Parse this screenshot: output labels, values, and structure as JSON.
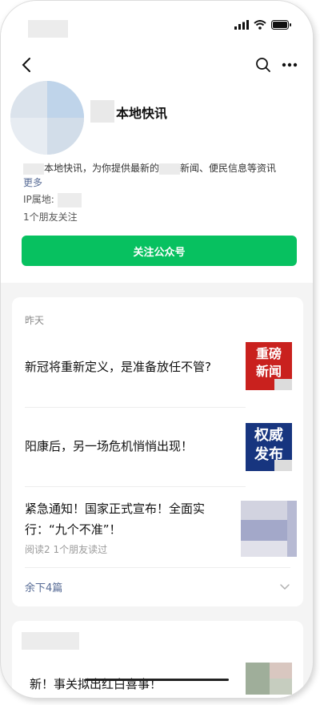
{
  "header": {
    "account_name": "本地快讯",
    "description": "本地快讯，为你提供最新的",
    "description_tail": "新闻、便民信息等资讯",
    "more_link": "更多",
    "ip_label": "IP属地:",
    "friends_following": "1个朋友关注",
    "follow_button": "关注公众号"
  },
  "feed": {
    "date": "昨天",
    "articles": [
      {
        "title": "新冠将重新定义，是准备放任不管?",
        "thumb_text": "重磅新闻",
        "thumb_style": "red"
      },
      {
        "title": "阳康后，另一场危机悄悄出现！",
        "thumb_text": "权威发布",
        "thumb_style": "blue"
      },
      {
        "title_line1": "紧急通知！国家正式宣布！全面实",
        "title_line2": "行：“九个不准”！",
        "meta": "阅读2  1个朋友读过",
        "thumb_style": "mosaic"
      }
    ],
    "remaining": "余下4篇"
  },
  "next_card": {
    "title": "新！事关拟出红白喜事！"
  },
  "colors": {
    "accent_green": "#07c160",
    "link_blue": "#576b95",
    "thumb_red": "#c9211e",
    "thumb_blue": "#17357f"
  },
  "icons": {
    "back": "chevron-left-icon",
    "search": "search-icon",
    "more": "more-dots-icon",
    "signal": "signal-icon",
    "wifi": "wifi-icon",
    "battery": "battery-icon",
    "expand": "chevron-down-icon"
  }
}
